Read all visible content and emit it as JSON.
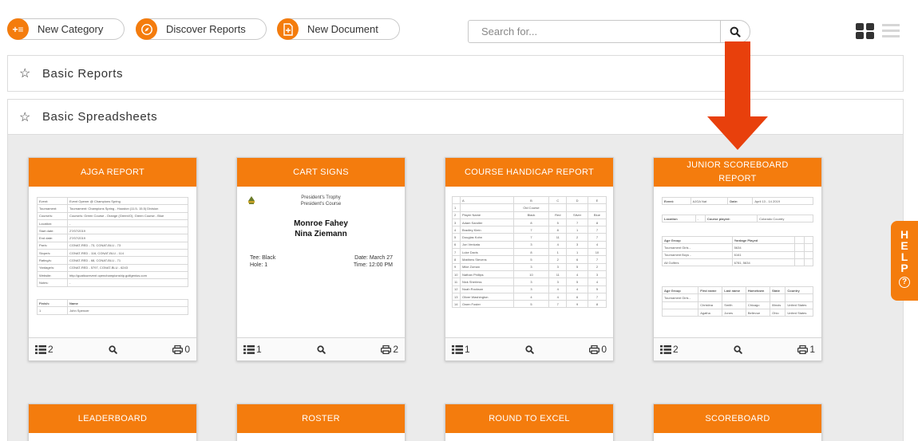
{
  "toolbar": {
    "new_category": "New Category",
    "discover_reports": "Discover Reports",
    "new_document": "New Document",
    "search_placeholder": "Search for..."
  },
  "sections": {
    "basic_reports": "Basic Reports",
    "basic_spreadsheets": "Basic Spreadsheets"
  },
  "cards": [
    {
      "title": "AJGA REPORT",
      "fields": "2",
      "prints": "0"
    },
    {
      "title": "CART SIGNS",
      "fields": "1",
      "prints": "2"
    },
    {
      "title": "COURSE HANDICAP REPORT",
      "fields": "1",
      "prints": "0"
    },
    {
      "title": "JUNIOR SCOREBOARD REPORT",
      "fields": "2",
      "prints": "1"
    },
    {
      "title": "LEADERBOARD"
    },
    {
      "title": "ROSTER"
    },
    {
      "title": "ROUND TO EXCEL"
    },
    {
      "title": "SCOREBOARD"
    }
  ],
  "cart_sign": {
    "trophy": "President's Trophy",
    "course": "President's Course",
    "player1": "Monroe Fahey",
    "player2": "Nina Ziemann",
    "tee": "Tee: Black",
    "hole": "Hole: 1",
    "date": "Date: March 27",
    "time": "Time: 12:00 PM"
  },
  "ajga_rows": [
    [
      "Event:",
      "Event Opener @ Champions Spring"
    ],
    [
      "Tournament:",
      "Tournament: Champions Spring - Houston (11.5- 15.5) Division"
    ],
    [
      "Course/s:",
      "Course/s: Green Course - Orange (Green/O), Green Course - Blue"
    ],
    [
      "Location:",
      "-"
    ],
    [
      "Start date:",
      "27/07/2019"
    ],
    [
      "End date:",
      "27/07/2019"
    ],
    [
      "Par/s:",
      "CGNAT-RED - 73, CGNAT-BLU - 73"
    ],
    [
      "Slope/s:",
      "CGNAT-RED - 116, CGNAT-BLU - 114"
    ],
    [
      "Rating/s:",
      "CGNAT-RED - 68, CGNAT-BLU - 71"
    ],
    [
      "Yardage/s:",
      "CGNAT-RED - 5797, CGNAT-BLU - 6243"
    ],
    [
      "Website:",
      "http://goaltourevent openchampionship.golfgenius.com"
    ],
    [
      "Notes:",
      "-"
    ]
  ],
  "ajga_finish": [
    [
      "Finish:",
      "Name"
    ],
    [
      "1",
      "John Spencer"
    ]
  ],
  "handicap_header": [
    "",
    "A",
    "B",
    "C",
    "D",
    "E"
  ],
  "handicap_rows": [
    [
      "1",
      "",
      "Old Course",
      "",
      "",
      ""
    ],
    [
      "2",
      "Player Name",
      "Black",
      "Red",
      "Silver",
      "Blue"
    ],
    [
      "3",
      "Adam Sandler",
      "8",
      "5",
      "7",
      "8"
    ],
    [
      "4",
      "Bradley Klein",
      "7",
      "8",
      "1",
      "7"
    ],
    [
      "5",
      "Douglas Kohn",
      "7",
      "11",
      "2",
      "7"
    ],
    [
      "6",
      "Jon Venkata",
      "3",
      "4",
      "3",
      "4"
    ],
    [
      "7",
      "Luke Davis",
      "8",
      "1",
      "1",
      "10"
    ],
    [
      "8",
      "Matthew Stevens",
      "5",
      "2",
      "6",
      "7"
    ],
    [
      "9",
      "Mike Zoman",
      "3",
      "3",
      "5",
      "2"
    ],
    [
      "10",
      "Nathan Phillips",
      "10",
      "11",
      "4",
      "3"
    ],
    [
      "11",
      "Nick Sherless",
      "3",
      "3",
      "5",
      "4"
    ],
    [
      "12",
      "Noah Rockson",
      "3",
      "4",
      "4",
      "5"
    ],
    [
      "13",
      "Oliver Washington",
      "4",
      "4",
      "6",
      "7"
    ],
    [
      "14",
      "Owen Foster",
      "5",
      "7",
      "9",
      "8"
    ]
  ],
  "junior": {
    "event_label": "Event:",
    "event_value": "AJGA Nat",
    "date_label": "Date:",
    "date_value": "April 13 - 14 2019",
    "location_label": "Location",
    "location_value": "-",
    "course_label": "Course played:",
    "course_value": "Colorado Country",
    "age_group": "Age Group",
    "yardage": "Yardage Played",
    "t_girls": "Tournament Girls -",
    "t_girls_v": "5634",
    "t_boys": "Tournament Boys -",
    "t_boys_v": "6161",
    "all_golfers": "All Golfers",
    "all_golfers_v": "6781, 5634",
    "cols": [
      "Age Group",
      "First name",
      "Last name",
      "Hometown",
      "State",
      "Country"
    ],
    "rows": [
      [
        "Tournament Girls -",
        "",
        "",
        "",
        "",
        ""
      ],
      [
        "",
        "Christina",
        "Smith",
        "Chicago",
        "Illinois",
        "United States"
      ],
      [
        "",
        "Agatha",
        "Jones",
        "Bellevue",
        "Ohio",
        "United States"
      ]
    ]
  },
  "help": {
    "letters": [
      "H",
      "E",
      "L",
      "P"
    ],
    "q": "?"
  },
  "colors": {
    "accent": "#f47c0d",
    "arrow": "#e8400c"
  }
}
